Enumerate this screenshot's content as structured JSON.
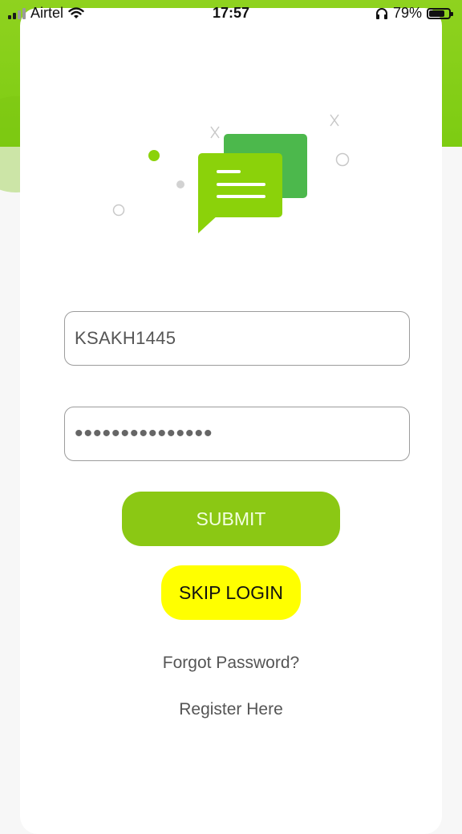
{
  "status_bar": {
    "carrier": "Airtel",
    "time": "17:57",
    "battery_percent": "79%",
    "battery_level": 0.79,
    "icons": [
      "signal-icon",
      "wifi-icon",
      "headphones-icon",
      "battery-icon"
    ]
  },
  "illustration": {
    "icon": "chat-bubbles-icon",
    "colors": {
      "front_bubble": "#8bd20a",
      "back_bubble": "#4cb84c",
      "accent_dot": "#8bd20a"
    }
  },
  "login_form": {
    "username_value": "KSAKH1445",
    "password_value": "•••••••••••••••",
    "submit_label": "SUBMIT",
    "skip_label": "SKIP LOGIN",
    "forgot_label": "Forgot Password?",
    "register_label": "Register Here"
  },
  "colors": {
    "brand_green": "#8bc814",
    "skip_yellow": "#ffff00",
    "background": "#f7f7f7"
  }
}
